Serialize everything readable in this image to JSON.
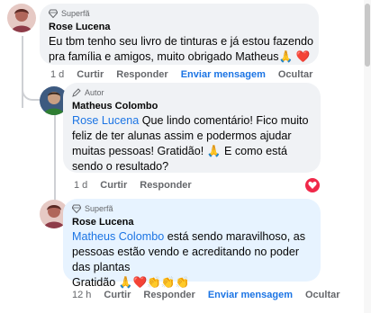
{
  "colors": {
    "mention": "#1b74e4",
    "heart": "#f02849",
    "highlight_bubble": "#e7f3ff",
    "bubble": "#f0f2f5"
  },
  "comments": [
    {
      "badge": "Superfã",
      "author": "Rose Lucena",
      "text_parts": [
        "Eu tbm tenho seu livro de tinturas e já estou fazendo pra família e amigos, muito obrigado Matheus",
        "🙏",
        "❤️"
      ],
      "time": "1 d",
      "like": "Curtir",
      "reply": "Responder",
      "message": "Enviar mensagem",
      "hide": "Ocultar"
    },
    {
      "badge": "Autor",
      "author": "Matheus Colombo",
      "mention": "Rose Lucena",
      "text": "Que lindo comentário! Fico muito feliz de ter alunas assim e podermos ajudar muitas pessoas! Gratidão! 🙏 E como está sendo o resultado?",
      "time": "1 d",
      "like": "Curtir",
      "reply": "Responder",
      "reaction_icon": "heart-reaction-icon"
    },
    {
      "badge": "Superfã",
      "author": "Rose Lucena",
      "mention": "Matheus Colombo",
      "text": "está sendo maravilhoso, as pessoas estão vendo e acreditando no poder das plantas",
      "text2": "Gratidão 🙏❤️👏👏👏",
      "time": "12 h",
      "like": "Curtir",
      "reply": "Responder",
      "message": "Enviar mensagem",
      "hide": "Ocultar"
    }
  ]
}
